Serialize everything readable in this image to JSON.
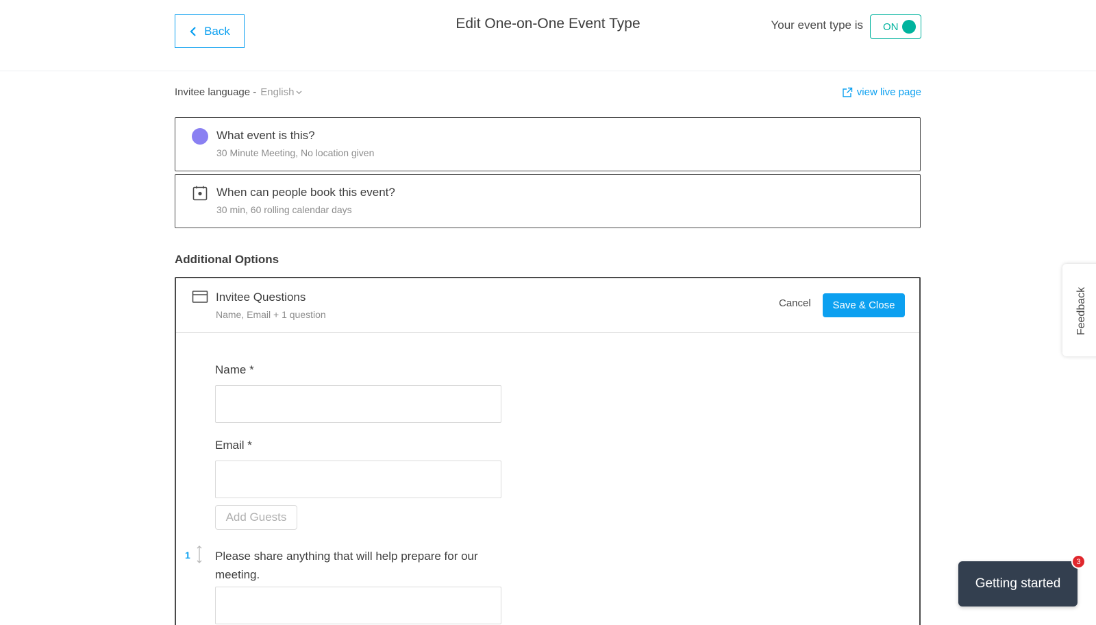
{
  "header": {
    "back_label": "Back",
    "title": "Edit One-on-One Event Type",
    "status_label": "Your event type is",
    "toggle_label": "ON"
  },
  "language": {
    "label": "Invitee language -",
    "value": "English"
  },
  "view_live_label": "view live page",
  "cards": [
    {
      "title": "What event is this?",
      "subtitle": "30 Minute Meeting, No location given",
      "icon": "purple-dot-icon"
    },
    {
      "title": "When can people book this event?",
      "subtitle": "30 min, 60 rolling calendar days",
      "icon": "calendar-icon"
    }
  ],
  "additional_options": {
    "heading": "Additional Options",
    "panel": {
      "title": "Invitee Questions",
      "subtitle": "Name, Email + 1 question",
      "icon": "form-card-icon",
      "cancel_label": "Cancel",
      "save_label": "Save & Close",
      "fields": [
        {
          "label": "Name *",
          "value": ""
        },
        {
          "label": "Email *",
          "value": ""
        }
      ],
      "add_guests_label": "Add Guests",
      "question": {
        "index": "1",
        "text": "Please share anything that will help prepare for our meeting."
      }
    }
  },
  "feedback_label": "Feedback",
  "getting_started": {
    "label": "Getting started",
    "badge_count": "3"
  },
  "colors": {
    "accent": "#0ca0f0",
    "toggle_on": "#00b39e",
    "event_dot": "#8a80f2",
    "badge": "#e0272d",
    "dark_button": "#333f4f"
  }
}
